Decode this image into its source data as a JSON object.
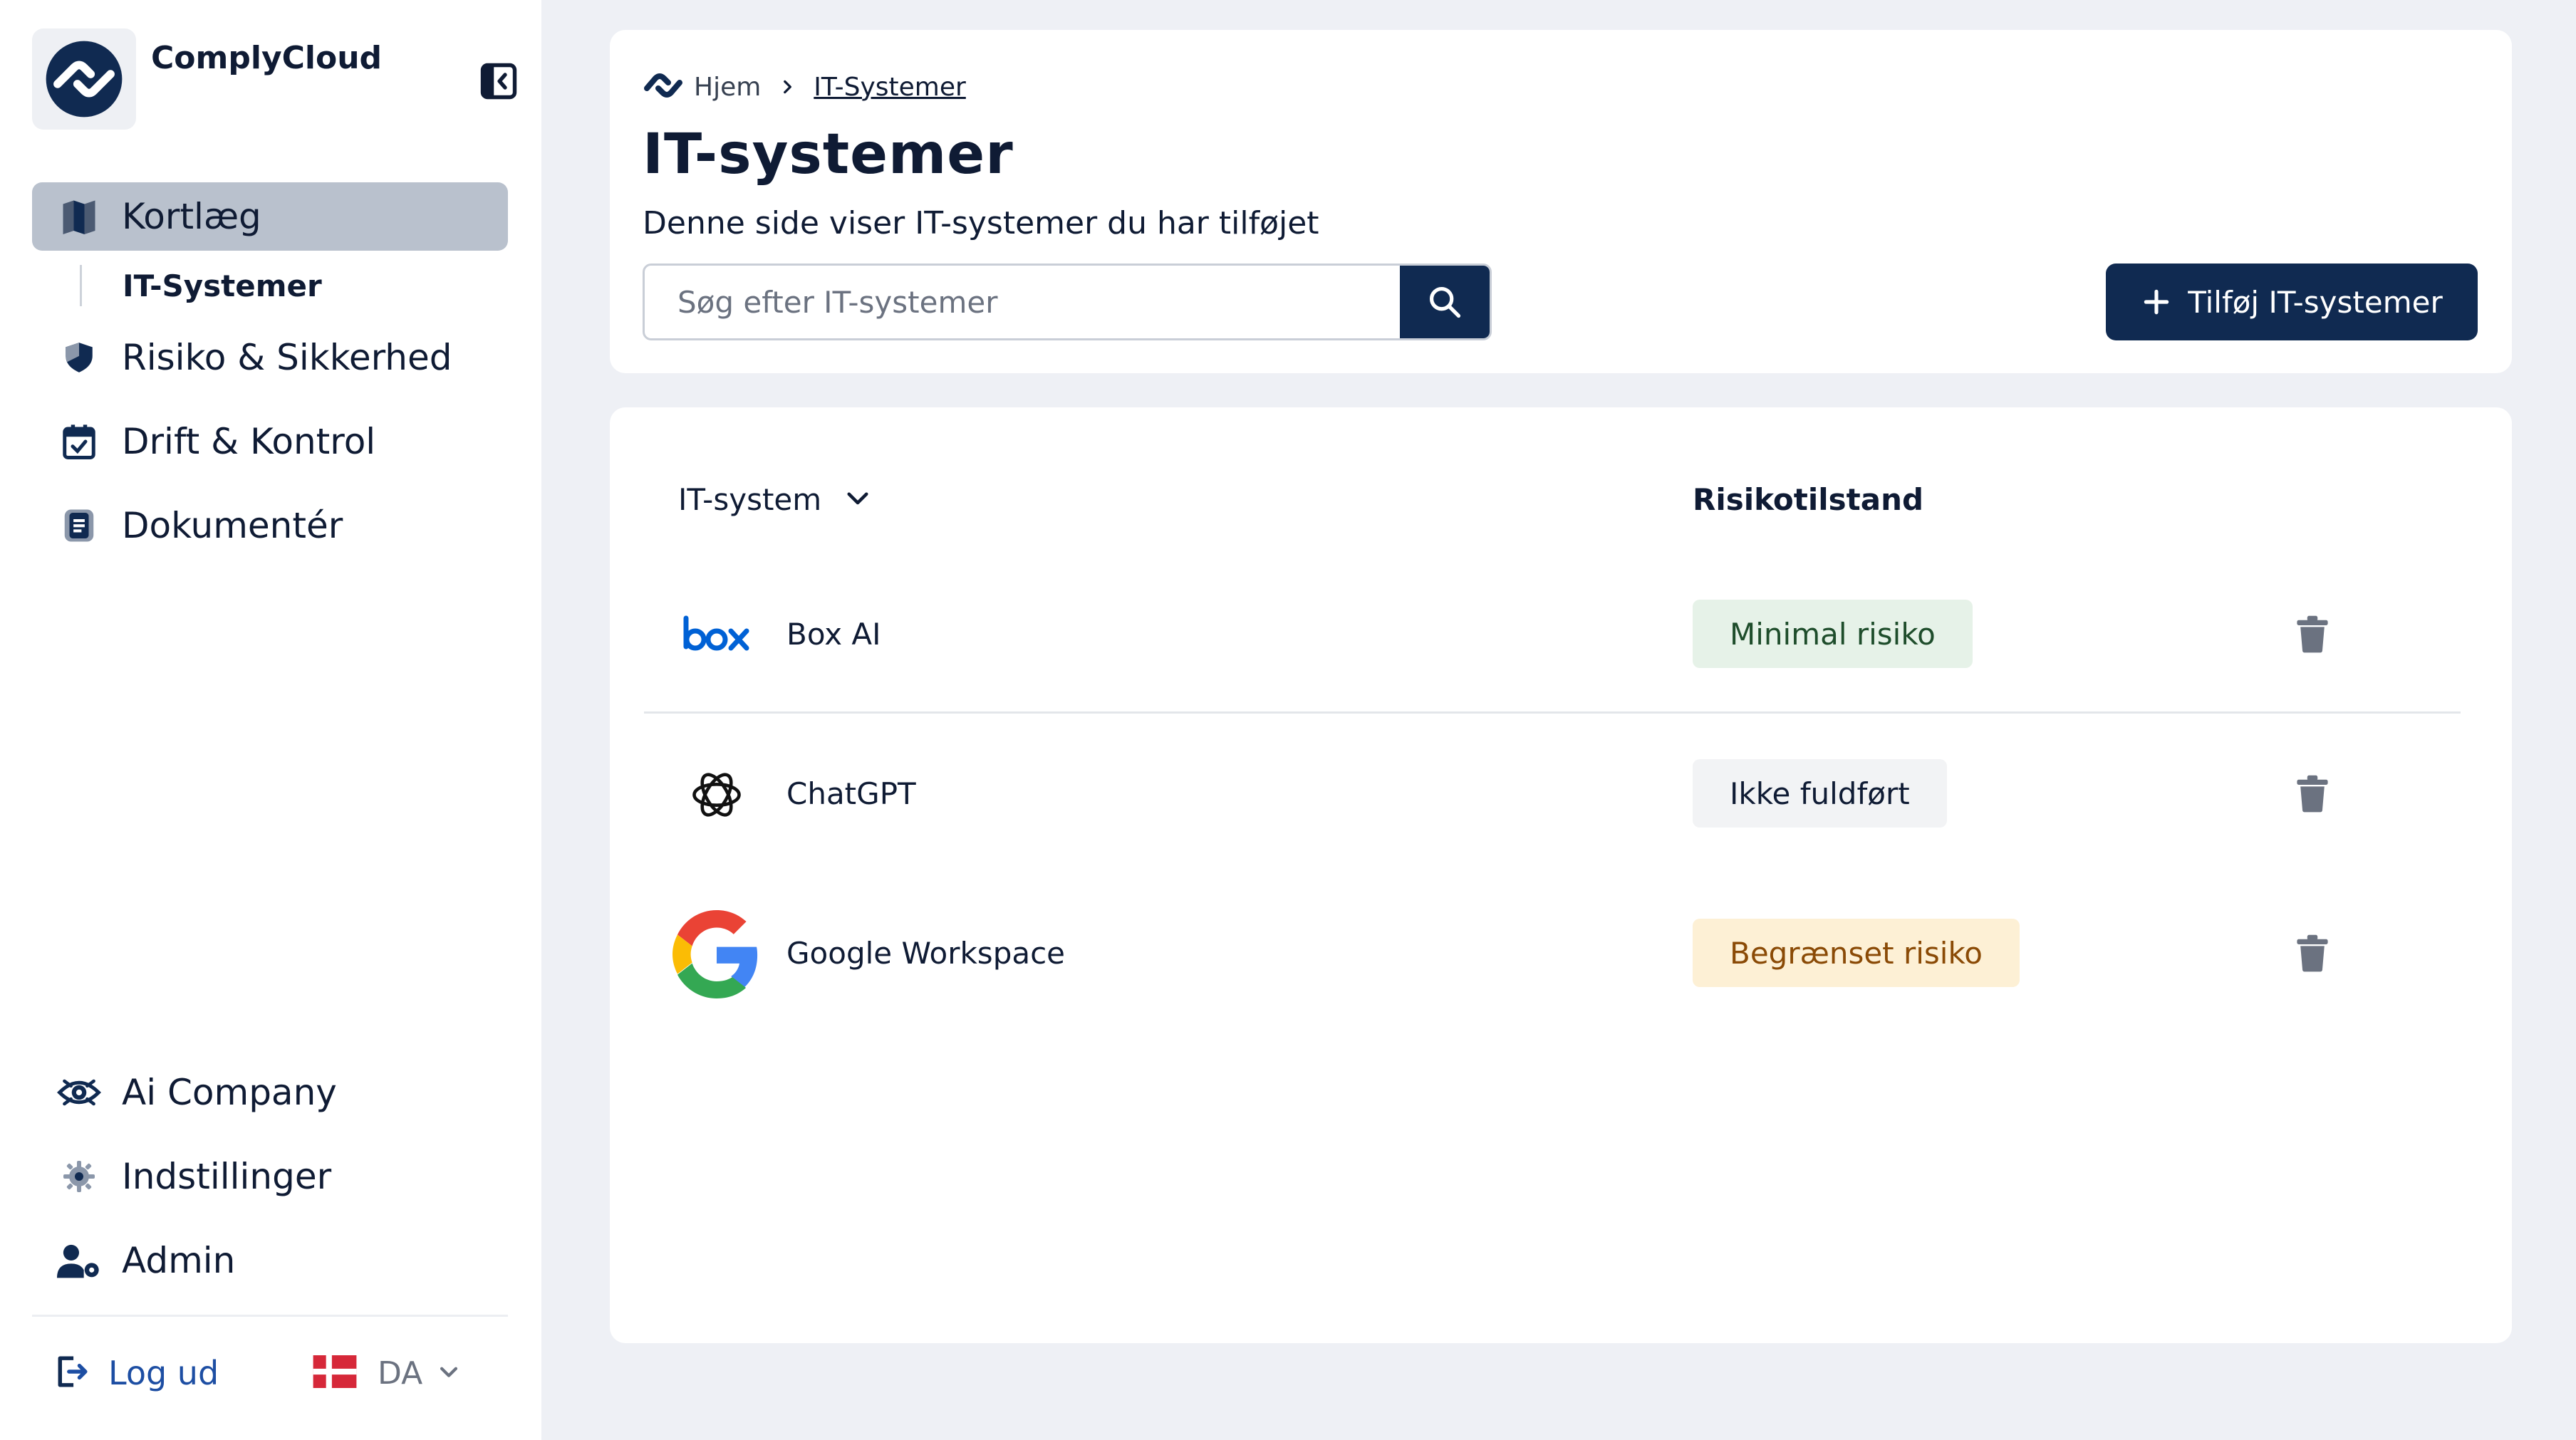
{
  "colors": {
    "primary": "#102a51",
    "link": "#1d4ea3",
    "page_bg": "#eef0f5",
    "active_nav": "#b9c1cd"
  },
  "brand": {
    "name": "ComplyCloud",
    "logo_icon": "complycloud-logo-icon"
  },
  "sidebar": {
    "collapse_icon": "sidebar-collapse-icon",
    "items": [
      {
        "label": "Kortlæg",
        "icon": "map-icon",
        "active": true
      },
      {
        "label": "Risiko & Sikkerhed",
        "icon": "shield-icon",
        "active": false
      },
      {
        "label": "Drift & Kontrol",
        "icon": "calendar-check-icon",
        "active": false
      },
      {
        "label": "Dokumentér",
        "icon": "document-icon",
        "active": false
      }
    ],
    "sub_item": {
      "label": "IT-Systemer"
    },
    "bottom_items": [
      {
        "label": "Ai Company",
        "icon": "company-eye-icon"
      },
      {
        "label": "Indstillinger",
        "icon": "gear-icon"
      },
      {
        "label": "Admin",
        "icon": "user-gear-icon"
      }
    ],
    "logout": {
      "label": "Log ud",
      "icon": "logout-icon"
    },
    "language": {
      "code": "DA",
      "flag": "denmark-flag-icon"
    }
  },
  "header": {
    "breadcrumb": {
      "home": "Hjem",
      "current": "IT-Systemer"
    },
    "title": "IT-systemer",
    "subtitle": "Denne side viser IT-systemer du har tilføjet",
    "search": {
      "placeholder": "Søg efter IT-systemer",
      "value": ""
    },
    "add_button": "Tilføj IT-systemer"
  },
  "table": {
    "columns": {
      "system": "IT-system",
      "risk": "Risikotilstand"
    },
    "rows": [
      {
        "name": "Box AI",
        "logo": "box-logo-icon",
        "risk": "Minimal risiko",
        "risk_bg": "#e6f2e8",
        "risk_fg": "#1e4d2b"
      },
      {
        "name": "ChatGPT",
        "logo": "openai-logo-icon",
        "risk": "Ikke fuldført",
        "risk_bg": "#f2f3f5",
        "risk_fg": "#0f1b34"
      },
      {
        "name": "Google Workspace",
        "logo": "google-logo-icon",
        "risk": "Begrænset risiko",
        "risk_bg": "#fdf0d5",
        "risk_fg": "#8a4a06"
      }
    ]
  }
}
